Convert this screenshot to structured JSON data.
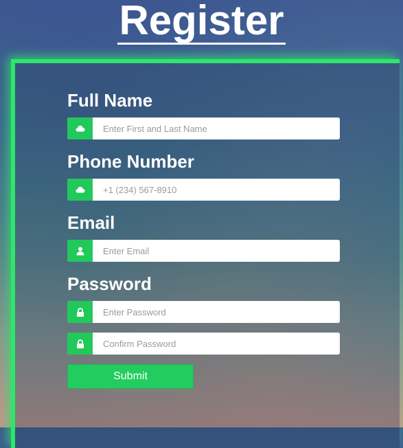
{
  "page": {
    "title": "Register"
  },
  "form": {
    "full_name": {
      "label": "Full Name",
      "placeholder": "Enter First and Last Name",
      "icon": "cloud-icon"
    },
    "phone": {
      "label": "Phone Number",
      "placeholder": "+1 (234) 567-8910",
      "icon": "cloud-icon"
    },
    "email": {
      "label": "Email",
      "placeholder": "Enter Email",
      "icon": "user-icon"
    },
    "password": {
      "label": "Password",
      "placeholder": "Enter Password",
      "confirm_placeholder": "Confirm Password",
      "icon": "lock-icon"
    },
    "submit_label": "Submit"
  },
  "colors": {
    "accent": "#22cc5e",
    "panel_border": "#2ee66a",
    "label_text": "#ffffff",
    "input_background": "#ffffff",
    "placeholder_text": "#9a9a9a"
  }
}
